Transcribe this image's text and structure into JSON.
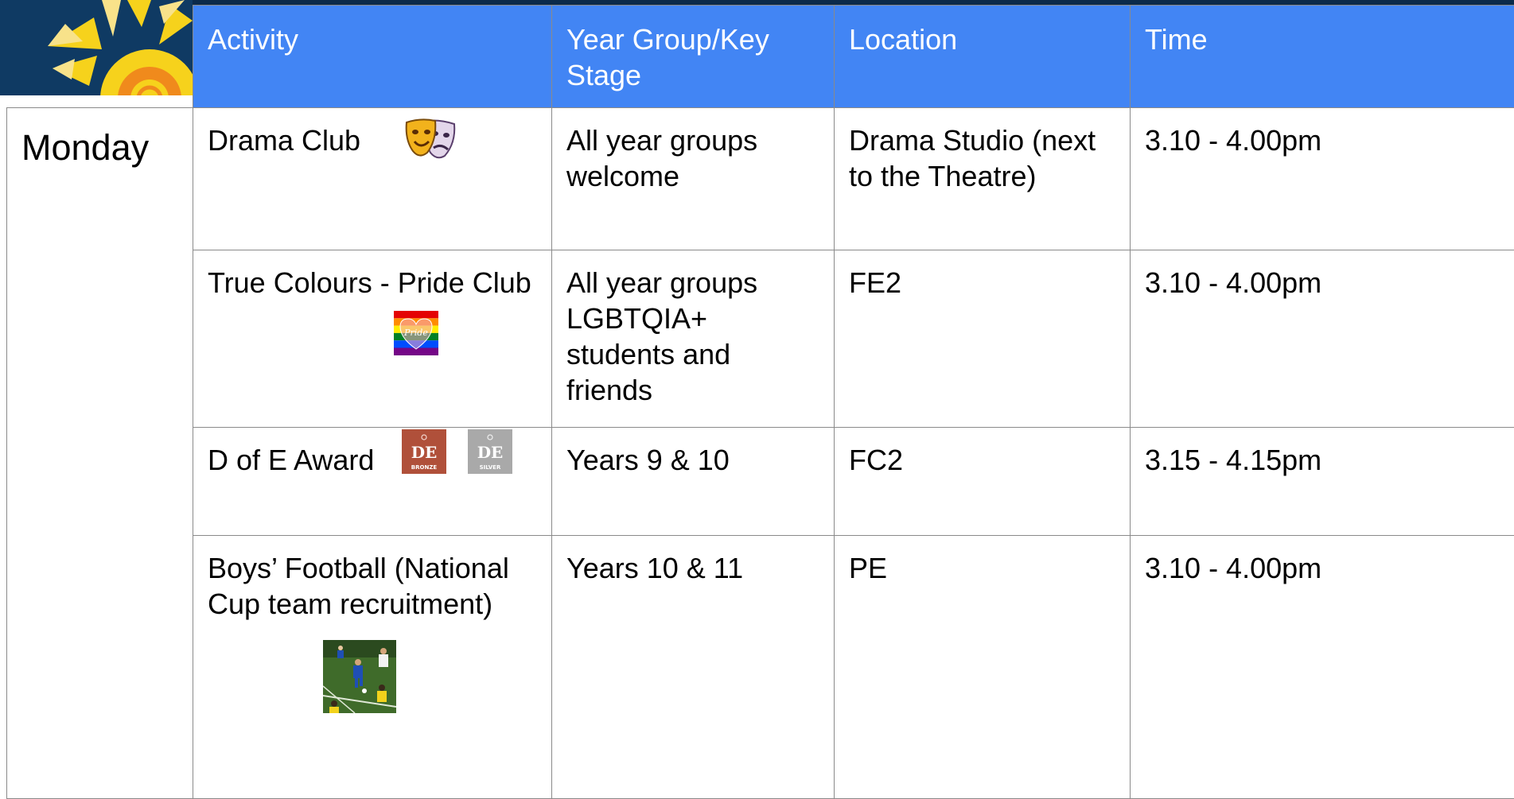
{
  "columns": {
    "activity": "Activity",
    "year_group": "Year Group/Key Stage",
    "location": "Location",
    "time": "Time"
  },
  "day": "Monday",
  "rows": [
    {
      "activity": "Drama Club",
      "year_group": "All year groups welcome",
      "location": "Drama Studio (next to the Theatre)",
      "time": "3.10 - 4.00pm",
      "icon": "drama-masks-icon"
    },
    {
      "activity": "True Colours - Pride Club",
      "year_group": "All year groups LGBTQIA+ students and friends",
      "location": "FE2",
      "time": "3.10 - 4.00pm",
      "icon": "pride-heart-icon"
    },
    {
      "activity": "D of E Award",
      "year_group": "Years 9 & 10",
      "location": "FC2",
      "time": "3.15 - 4.15pm",
      "icons": [
        "dofe-bronze-icon",
        "dofe-silver-icon"
      ]
    },
    {
      "activity": "Boys’ Football (National Cup team recruitment)",
      "year_group": "Years 10 & 11",
      "location": "PE",
      "time": "3.10 - 4.00pm",
      "icon": "football-photo-icon"
    }
  ],
  "badges": {
    "pride": "Pride",
    "dofe_bronze": "BRONZE",
    "dofe_silver": "SILVER",
    "dofe_mark": "DE"
  },
  "colors": {
    "header_blue": "#4285f4",
    "navy": "#0f3a63",
    "dofe_bronze": "#b0503a",
    "dofe_silver": "#a9a9a9"
  }
}
